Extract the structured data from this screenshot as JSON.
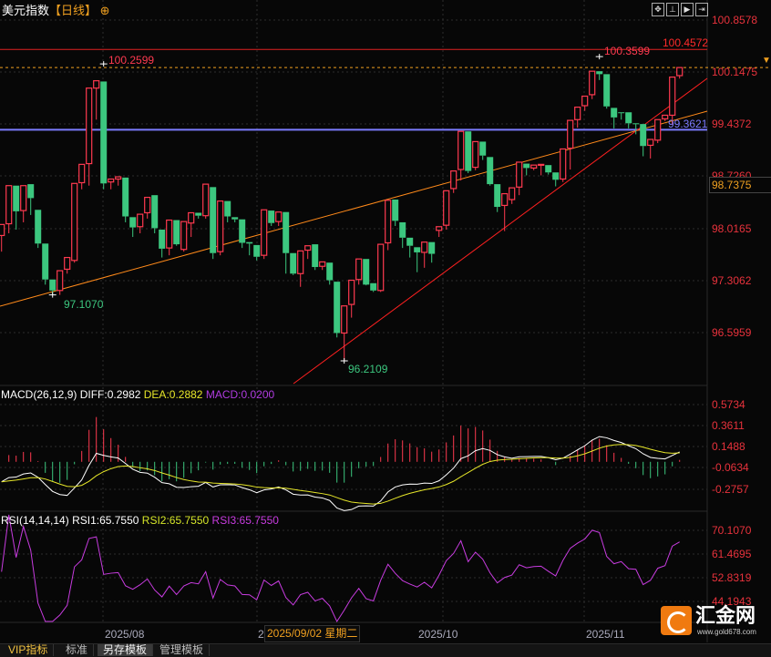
{
  "header": {
    "instrument": "美元指数",
    "period": "【日线】",
    "add_icon": "circle-plus-icon"
  },
  "toolbar": {
    "icons": [
      "crosshair-icon",
      "zoom-range-icon",
      "play-icon",
      "scroll-end-icon"
    ]
  },
  "price_axis": {
    "labels": [
      "100.8578",
      "100.1475",
      "99.4372",
      "98.7260",
      "98.0165",
      "97.3062",
      "96.5959"
    ],
    "current_price": "98.7375"
  },
  "annotations": {
    "high_1": "100.2599",
    "low_1": "97.1070",
    "low_2": "96.2109",
    "high_2": "100.3599",
    "resistance": "100.4572",
    "support": "99.3621"
  },
  "macd": {
    "title": "MACD(26,12,9)",
    "diff": "DIFF:0.2982",
    "dea": "DEA:0.2882",
    "macd": "MACD:0.0200",
    "axis_labels": [
      "0.5734",
      "0.3611",
      "0.1488",
      "-0.0634",
      "-0.2757"
    ]
  },
  "rsi": {
    "title": "RSI(14,14,14)",
    "rsi1": "RSI1:65.7550",
    "rsi2": "RSI2:65.7550",
    "rsi3": "RSI3:65.7550",
    "axis_labels": [
      "70.1070",
      "61.4695",
      "52.8319",
      "44.1943"
    ]
  },
  "time_axis": {
    "labels": [
      "2025/08",
      "2",
      "2025/10",
      "2025/11"
    ],
    "cursor_date": "2025/09/02 星期二"
  },
  "bottom_tabs": [
    "VIP指标",
    "标准",
    "另存模板",
    "管理模板"
  ],
  "logo": {
    "name": "汇金网",
    "url_text": "www.gold678.com"
  },
  "colors": {
    "up": "#ff3a50",
    "down": "#3cc77f",
    "support_line": "#7b7bff",
    "trendline": "#ff8a1a",
    "resistance": "#e02020",
    "rsi": "#c83ce0",
    "dea": "#e6e629"
  },
  "chart_data": {
    "type": "candlestick",
    "price_range": [
      96.0,
      100.95
    ],
    "grid": true,
    "horizontal_lines": {
      "resistance": 100.4572,
      "support": 99.3621,
      "last_close_dashed": 100.21
    },
    "candles_ohlc": [
      [
        97.92,
        98.3,
        97.7,
        98.07
      ],
      [
        98.08,
        98.65,
        97.95,
        98.6
      ],
      [
        98.6,
        98.8,
        98.0,
        98.25
      ],
      [
        98.26,
        98.8,
        98.1,
        98.6
      ],
      [
        98.62,
        98.68,
        98.2,
        98.43
      ],
      [
        98.27,
        98.45,
        97.75,
        97.81
      ],
      [
        97.81,
        97.95,
        97.25,
        97.32
      ],
      [
        97.32,
        97.4,
        97.11,
        97.17
      ],
      [
        97.17,
        97.6,
        97.11,
        97.44
      ],
      [
        97.46,
        97.95,
        97.4,
        97.62
      ],
      [
        97.58,
        98.65,
        97.55,
        98.63
      ],
      [
        98.64,
        99.13,
        98.55,
        98.89
      ],
      [
        98.9,
        99.98,
        98.6,
        99.93
      ],
      [
        99.93,
        100.07,
        99.5,
        100.03
      ],
      [
        100.02,
        100.26,
        98.55,
        98.63
      ],
      [
        98.65,
        98.95,
        98.55,
        98.69
      ],
      [
        98.69,
        99.0,
        98.6,
        98.72
      ],
      [
        98.71,
        98.8,
        98.1,
        98.18
      ],
      [
        98.17,
        98.2,
        97.9,
        98.03
      ],
      [
        98.04,
        98.27,
        97.95,
        98.21
      ],
      [
        98.23,
        98.64,
        98.15,
        98.44
      ],
      [
        98.47,
        98.6,
        97.95,
        98.02
      ],
      [
        98.0,
        98.08,
        97.62,
        97.74
      ],
      [
        97.75,
        98.29,
        97.65,
        98.13
      ],
      [
        98.13,
        98.28,
        97.78,
        97.8
      ],
      [
        97.73,
        98.22,
        97.7,
        98.11
      ],
      [
        98.09,
        98.38,
        97.9,
        98.23
      ],
      [
        98.23,
        98.3,
        98.15,
        98.19
      ],
      [
        98.19,
        98.65,
        98.15,
        98.62
      ],
      [
        98.58,
        98.8,
        97.6,
        97.68
      ],
      [
        97.7,
        98.5,
        97.65,
        98.39
      ],
      [
        98.39,
        98.48,
        98.1,
        98.18
      ],
      [
        98.17,
        98.6,
        98.1,
        98.14
      ],
      [
        98.14,
        98.16,
        97.75,
        97.82
      ],
      [
        97.83,
        98.05,
        97.65,
        97.81
      ],
      [
        97.79,
        97.85,
        97.58,
        97.63
      ],
      [
        97.65,
        98.56,
        97.6,
        98.27
      ],
      [
        98.26,
        98.6,
        98.05,
        98.09
      ],
      [
        98.11,
        98.4,
        98.05,
        98.24
      ],
      [
        98.24,
        98.27,
        97.4,
        97.68
      ],
      [
        97.68,
        97.92,
        97.38,
        97.4
      ],
      [
        97.4,
        97.74,
        97.22,
        97.71
      ],
      [
        97.72,
        97.82,
        97.6,
        97.78
      ],
      [
        97.8,
        98.06,
        97.45,
        97.49
      ],
      [
        97.5,
        97.7,
        97.45,
        97.56
      ],
      [
        97.55,
        97.6,
        97.25,
        97.31
      ],
      [
        97.29,
        97.3,
        96.53,
        96.59
      ],
      [
        96.59,
        97.03,
        96.21,
        96.96
      ],
      [
        96.98,
        97.42,
        96.8,
        97.31
      ],
      [
        97.32,
        97.7,
        97.25,
        97.6
      ],
      [
        97.6,
        97.71,
        97.24,
        97.25
      ],
      [
        97.27,
        97.3,
        97.15,
        97.17
      ],
      [
        97.17,
        97.86,
        97.15,
        97.8
      ],
      [
        97.82,
        98.55,
        97.72,
        98.4
      ],
      [
        98.41,
        98.45,
        98.05,
        98.12
      ],
      [
        98.1,
        98.15,
        97.75,
        97.89
      ],
      [
        97.89,
        98.0,
        97.62,
        97.78
      ],
      [
        97.76,
        97.81,
        97.42,
        97.69
      ],
      [
        97.69,
        98.0,
        97.48,
        97.83
      ],
      [
        97.83,
        97.9,
        97.55,
        97.67
      ],
      [
        97.99,
        98.07,
        97.9,
        98.04
      ],
      [
        98.06,
        98.6,
        98.0,
        98.53
      ],
      [
        98.56,
        98.98,
        98.5,
        98.8
      ],
      [
        98.82,
        99.53,
        98.67,
        99.34
      ],
      [
        99.34,
        99.45,
        98.77,
        98.8
      ],
      [
        98.85,
        99.34,
        98.81,
        99.2
      ],
      [
        99.2,
        99.39,
        98.95,
        99.01
      ],
      [
        98.99,
        99.02,
        98.6,
        98.62
      ],
      [
        98.62,
        98.65,
        98.24,
        98.31
      ],
      [
        98.33,
        98.56,
        97.98,
        98.49
      ],
      [
        98.41,
        98.61,
        98.35,
        98.57
      ],
      [
        98.58,
        98.93,
        98.47,
        98.92
      ],
      [
        98.9,
        99.12,
        98.74,
        98.84
      ],
      [
        98.84,
        99.04,
        98.81,
        98.88
      ],
      [
        98.88,
        99.04,
        98.74,
        98.89
      ],
      [
        98.88,
        98.96,
        98.75,
        98.78
      ],
      [
        98.78,
        98.83,
        98.59,
        98.68
      ],
      [
        98.69,
        99.13,
        98.65,
        99.1
      ],
      [
        99.11,
        99.71,
        98.82,
        99.49
      ],
      [
        99.5,
        99.71,
        99.39,
        99.67
      ],
      [
        99.69,
        99.89,
        99.62,
        99.82
      ],
      [
        99.84,
        100.19,
        99.78,
        100.16
      ],
      [
        100.16,
        100.36,
        100.04,
        100.12
      ],
      [
        100.12,
        100.15,
        99.65,
        99.68
      ],
      [
        99.66,
        99.86,
        99.38,
        99.53
      ],
      [
        99.6,
        99.72,
        99.5,
        99.59
      ],
      [
        99.6,
        99.72,
        99.38,
        99.45
      ],
      [
        99.45,
        99.62,
        99.3,
        99.44
      ],
      [
        99.44,
        99.56,
        99.0,
        99.14
      ],
      [
        99.15,
        99.45,
        98.97,
        99.23
      ],
      [
        99.22,
        99.56,
        99.18,
        99.5
      ],
      [
        99.51,
        99.64,
        99.48,
        99.56
      ],
      [
        99.56,
        100.13,
        99.43,
        100.08
      ],
      [
        100.1,
        100.29,
        100.06,
        100.21
      ]
    ],
    "macd_range": [
      -0.2757,
      0.5734
    ],
    "rsi_range": [
      44.1943,
      70.107
    ]
  }
}
